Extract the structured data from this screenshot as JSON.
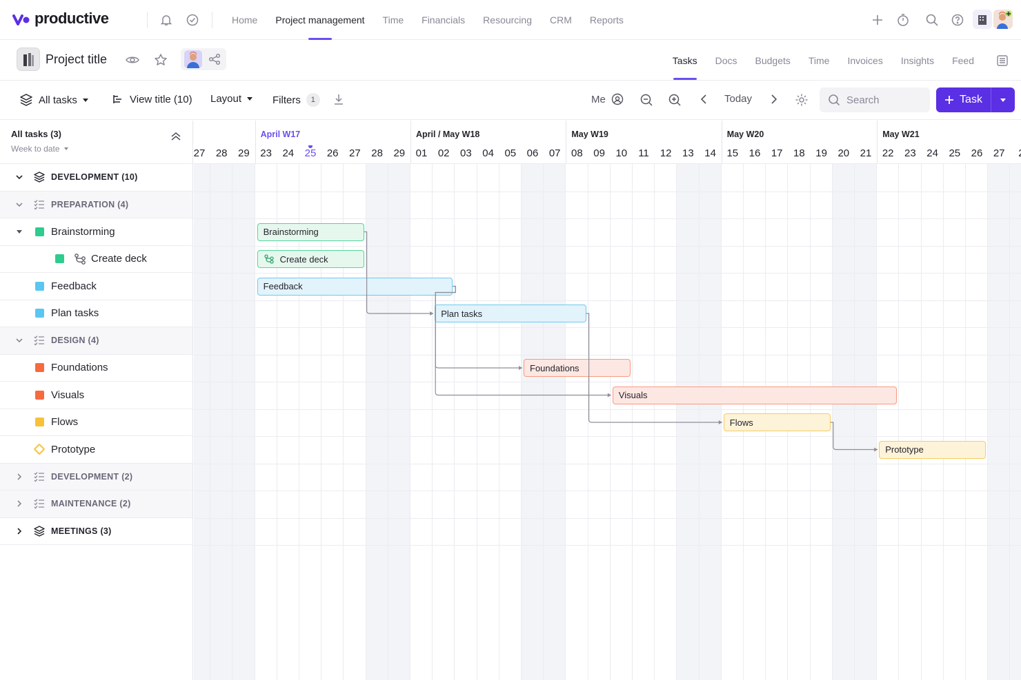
{
  "app": {
    "name": "productive"
  },
  "nav": {
    "links": [
      "Home",
      "Project management",
      "Time",
      "Financials",
      "Resourcing",
      "CRM",
      "Reports"
    ],
    "active": "Project management"
  },
  "project": {
    "title": "Project  title",
    "tabs": [
      "Tasks",
      "Docs",
      "Budgets",
      "Time",
      "Invoices",
      "Insights",
      "Feed"
    ],
    "active_tab": "Tasks"
  },
  "toolbar": {
    "all_tasks": "All tasks",
    "view_title": "View title (10)",
    "layout": "Layout",
    "filters": "Filters",
    "filters_count": "1",
    "me": "Me",
    "today": "Today",
    "search_placeholder": "Search",
    "task_button": "Task"
  },
  "left_panel": {
    "title": "All tasks (3)",
    "subtitle": "Week to date",
    "rows": [
      {
        "kind": "group",
        "label": "DEVELOPMENT (10)",
        "expanded": true
      },
      {
        "kind": "subgroup",
        "label": "PREPARATION (4)",
        "expanded": true
      },
      {
        "kind": "task",
        "label": "Brainstorming",
        "color": "#2ecc8f",
        "has_toggle": true
      },
      {
        "kind": "subtask",
        "label": "Create deck",
        "color": "#2ecc8f"
      },
      {
        "kind": "task",
        "label": "Feedback",
        "color": "#5bc6f2"
      },
      {
        "kind": "task",
        "label": "Plan tasks",
        "color": "#5bc6f2"
      },
      {
        "kind": "subgroup",
        "label": "DESIGN (4)",
        "expanded": true
      },
      {
        "kind": "task",
        "label": "Foundations",
        "color": "#f76a3e"
      },
      {
        "kind": "task",
        "label": "Visuals",
        "color": "#f76a3e"
      },
      {
        "kind": "task",
        "label": "Flows",
        "color": "#f7c23a"
      },
      {
        "kind": "milestone",
        "label": "Prototype",
        "color": "#f7c23a"
      },
      {
        "kind": "subgroup",
        "label": "DEVELOPMENT (2)",
        "expanded": false
      },
      {
        "kind": "subgroup",
        "label": "MAINTENANCE (2)",
        "expanded": false
      },
      {
        "kind": "group",
        "label": "MEETINGS (3)",
        "expanded": false
      }
    ]
  },
  "timeline": {
    "weeks": [
      {
        "label": "April W17",
        "current": true
      },
      {
        "label": "April / May W18",
        "current": false
      },
      {
        "label": "May  W19",
        "current": false
      },
      {
        "label": "May  W20",
        "current": false
      },
      {
        "label": "May  W21",
        "current": false
      }
    ],
    "days": [
      "27",
      "28",
      "29",
      "23",
      "24",
      "25",
      "26",
      "27",
      "28",
      "29",
      "01",
      "02",
      "03",
      "04",
      "05",
      "06",
      "07",
      "08",
      "09",
      "10",
      "11",
      "12",
      "13",
      "14",
      "15",
      "16",
      "17",
      "18",
      "19",
      "20",
      "21",
      "22",
      "23",
      "24",
      "25",
      "26",
      "27",
      "2"
    ],
    "today": "25",
    "bars": [
      {
        "label": "Brainstorming",
        "color": "green",
        "row": 2
      },
      {
        "label": "Create deck",
        "color": "green",
        "row": 3,
        "icon": "subtask-icon"
      },
      {
        "label": "Feedback",
        "color": "blue",
        "row": 4
      },
      {
        "label": "Plan tasks",
        "color": "blue",
        "row": 5
      },
      {
        "label": "Foundations",
        "color": "orange",
        "row": 7
      },
      {
        "label": "Visuals",
        "color": "orange",
        "row": 8
      },
      {
        "label": "Flows",
        "color": "yellow",
        "row": 9
      },
      {
        "label": "Prototype",
        "color": "yellow",
        "row": 10
      }
    ]
  }
}
